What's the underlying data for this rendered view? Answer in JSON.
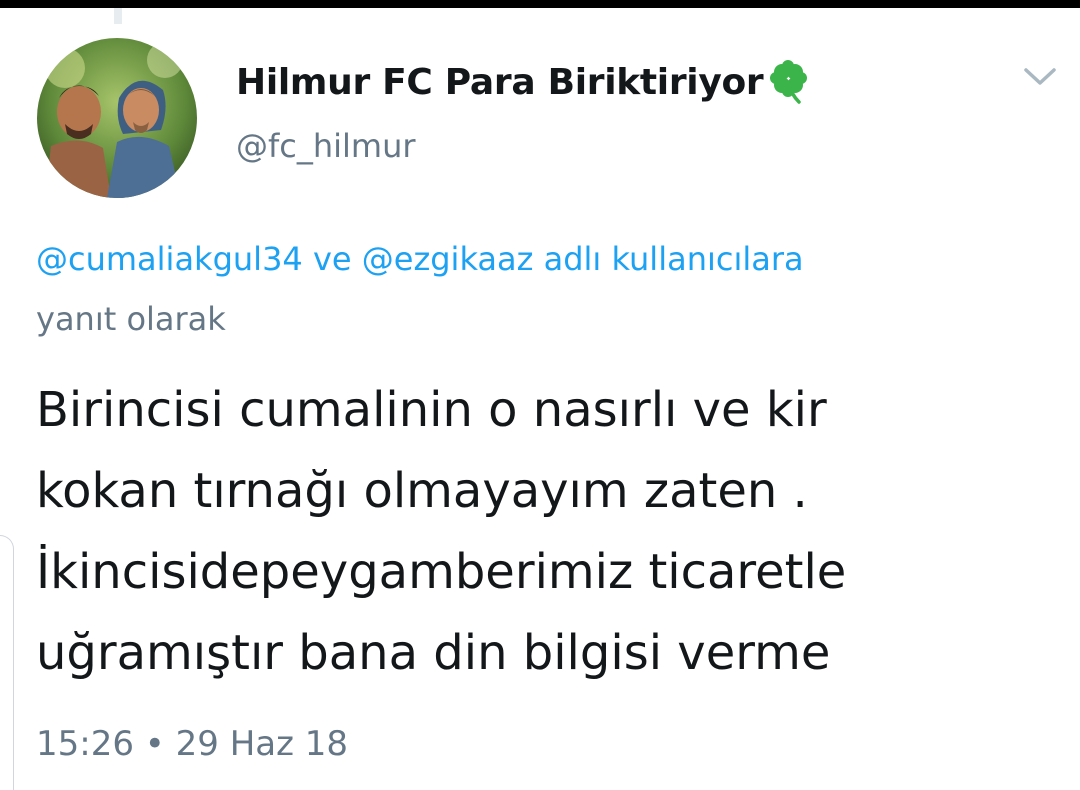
{
  "tweet": {
    "display_name": "Hilmur FC Para Biriktiriyor",
    "name_emoji_icon": "four-leaf-clover-icon",
    "handle": "@fc_hilmur",
    "reply_to": {
      "user1": "@cumaliakgul34",
      "connector": " ve ",
      "user2": "@ezgikaaz",
      "suffix": " adlı kullanıcılara",
      "line2": "yanıt olarak"
    },
    "text_lines": [
      "Birincisi cumalinin o nasırlı ve kir",
      "kokan tırnağı olmayayım zaten .",
      "İkincisidepeygamberimiz ticaretle",
      "uğramıştır bana din bilgisi verme"
    ],
    "time": "15:26",
    "separator": " • ",
    "date": "29 Haz 18"
  },
  "colors": {
    "link": "#1da1f2",
    "secondary_text": "#657786",
    "primary_text": "#14171a",
    "clover": "#3bb54a"
  }
}
